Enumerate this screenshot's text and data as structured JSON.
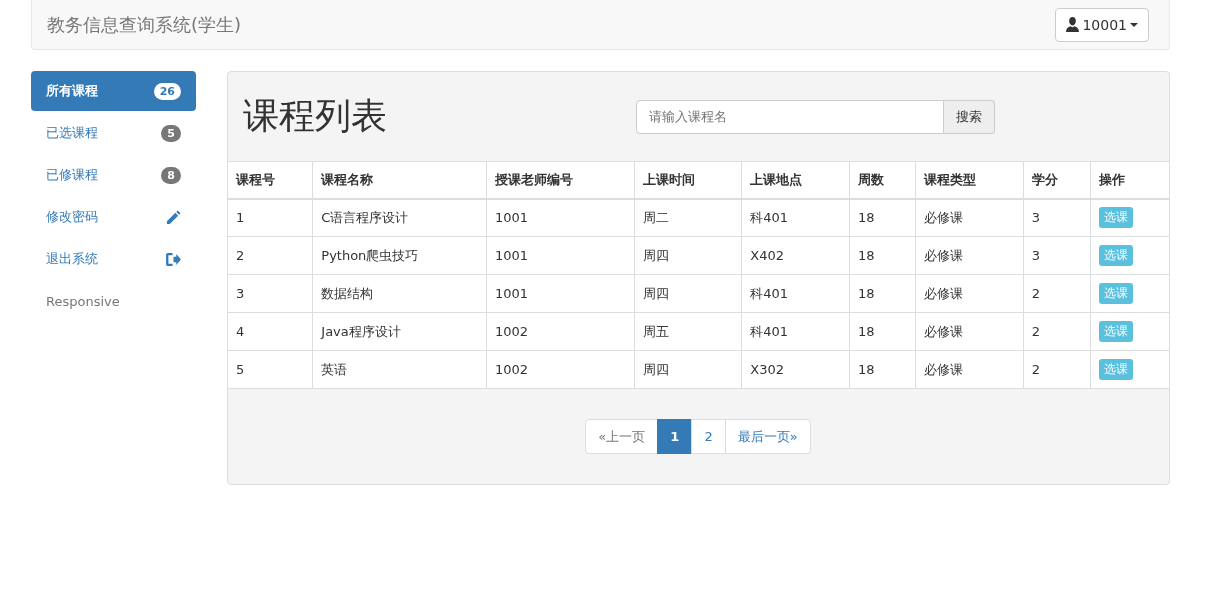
{
  "navbar": {
    "brand": "教务信息查询系统(学生)",
    "user": "10001"
  },
  "sidebar": {
    "items": [
      {
        "label": "所有课程",
        "kind": "badge",
        "badge": "26",
        "selected": true
      },
      {
        "label": "已选课程",
        "kind": "badge",
        "badge": "5",
        "selected": false
      },
      {
        "label": "已修课程",
        "kind": "badge",
        "badge": "8",
        "selected": false
      },
      {
        "label": "修改密码",
        "kind": "edit",
        "selected": false
      },
      {
        "label": "退出系统",
        "kind": "exit",
        "selected": false
      },
      {
        "label": "Responsive",
        "kind": "plain",
        "selected": false
      }
    ]
  },
  "panel": {
    "title": "课程列表",
    "search": {
      "placeholder": "请输入课程名",
      "button": "搜索"
    }
  },
  "table": {
    "columns": [
      "课程号",
      "课程名称",
      "授课老师编号",
      "上课时间",
      "上课地点",
      "周数",
      "课程类型",
      "学分",
      "操作"
    ],
    "rows": [
      {
        "cells": [
          "1",
          "C语言程序设计",
          "1001",
          "周二",
          "科401",
          "18",
          "必修课",
          "3"
        ],
        "action": "选课"
      },
      {
        "cells": [
          "2",
          "Python爬虫技巧",
          "1001",
          "周四",
          "X402",
          "18",
          "必修课",
          "3"
        ],
        "action": "选课"
      },
      {
        "cells": [
          "3",
          "数据结构",
          "1001",
          "周四",
          "科401",
          "18",
          "必修课",
          "2"
        ],
        "action": "选课"
      },
      {
        "cells": [
          "4",
          "Java程序设计",
          "1002",
          "周五",
          "科401",
          "18",
          "必修课",
          "2"
        ],
        "action": "选课"
      },
      {
        "cells": [
          "5",
          "英语",
          "1002",
          "周四",
          "X302",
          "18",
          "必修课",
          "2"
        ],
        "action": "选课"
      }
    ]
  },
  "pagination": [
    {
      "label": "«上一页",
      "selected": false,
      "disabled": true
    },
    {
      "label": "1",
      "selected": true,
      "disabled": false
    },
    {
      "label": "2",
      "selected": false,
      "disabled": false
    },
    {
      "label": "最后一页»",
      "selected": false,
      "disabled": false
    }
  ]
}
